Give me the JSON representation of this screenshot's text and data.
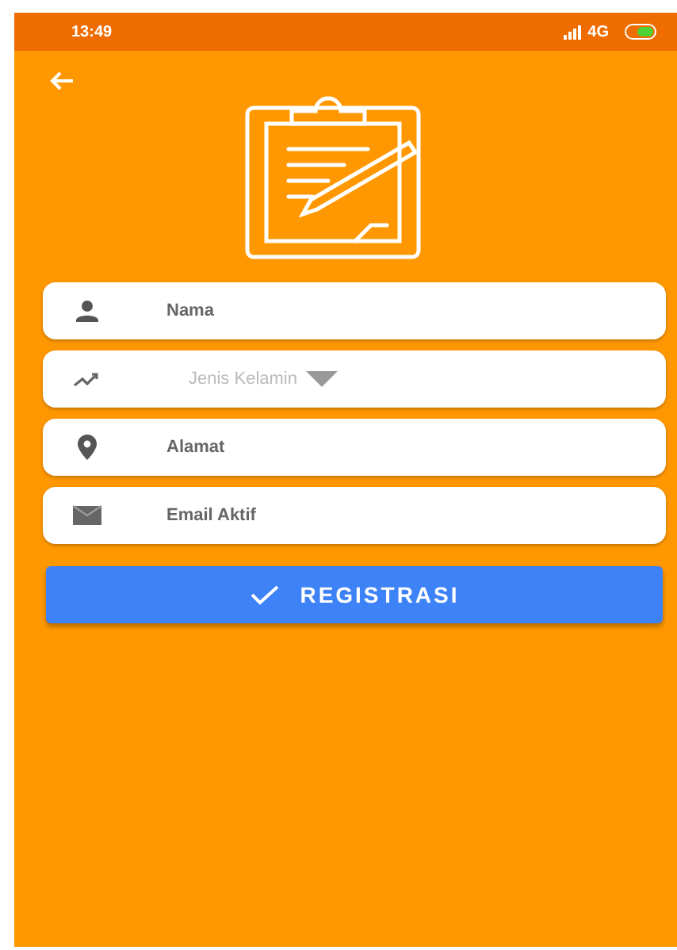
{
  "status_bar": {
    "time": "13:49",
    "network": "4G"
  },
  "fields": [
    {
      "kind": "text",
      "placeholder": "Nama"
    },
    {
      "kind": "dropdown",
      "placeholder": "Jenis Kelamin"
    },
    {
      "kind": "text",
      "placeholder": "Alamat"
    },
    {
      "kind": "text",
      "placeholder": "Email Aktif"
    }
  ],
  "submit": {
    "label": "REGISTRASI"
  }
}
